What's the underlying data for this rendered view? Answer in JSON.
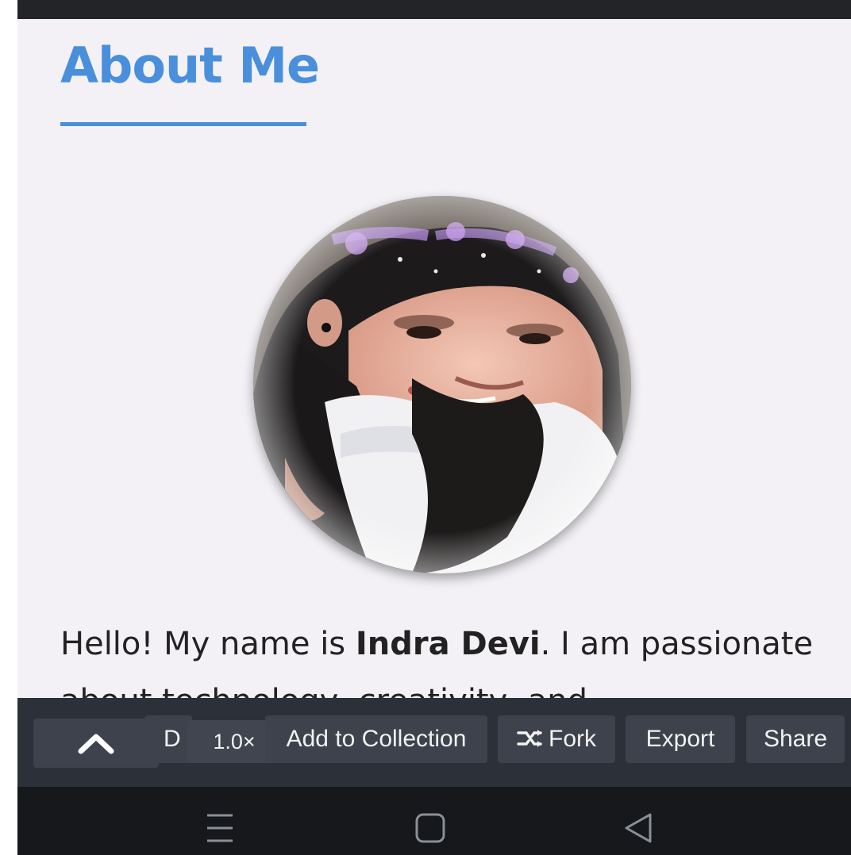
{
  "about": {
    "heading": "About Me",
    "photo_icon": "profile-photo",
    "bio_intro": "Hello! My name is ",
    "bio_name": "Indra Devi",
    "bio_rest": ". I am passionate about technology, creativity, and"
  },
  "toolbar": {
    "collapse_icon": "chevron-up-icon",
    "peek_label": "D",
    "speed_label": "1.0×",
    "add_collection_label": "Add to Collection",
    "fork_icon": "fork-icon",
    "fork_label": "Fork",
    "export_label": "Export",
    "share_label": "Share"
  },
  "navbar": {
    "icons": [
      "menu-icon",
      "home-icon",
      "back-icon"
    ]
  },
  "colors": {
    "accent": "#4a8fdb",
    "page_bg": "#f3f1f6",
    "toolbar_bg": "#2c3039",
    "button_bg": "#3d424d",
    "navbar_bg": "#16181b"
  }
}
